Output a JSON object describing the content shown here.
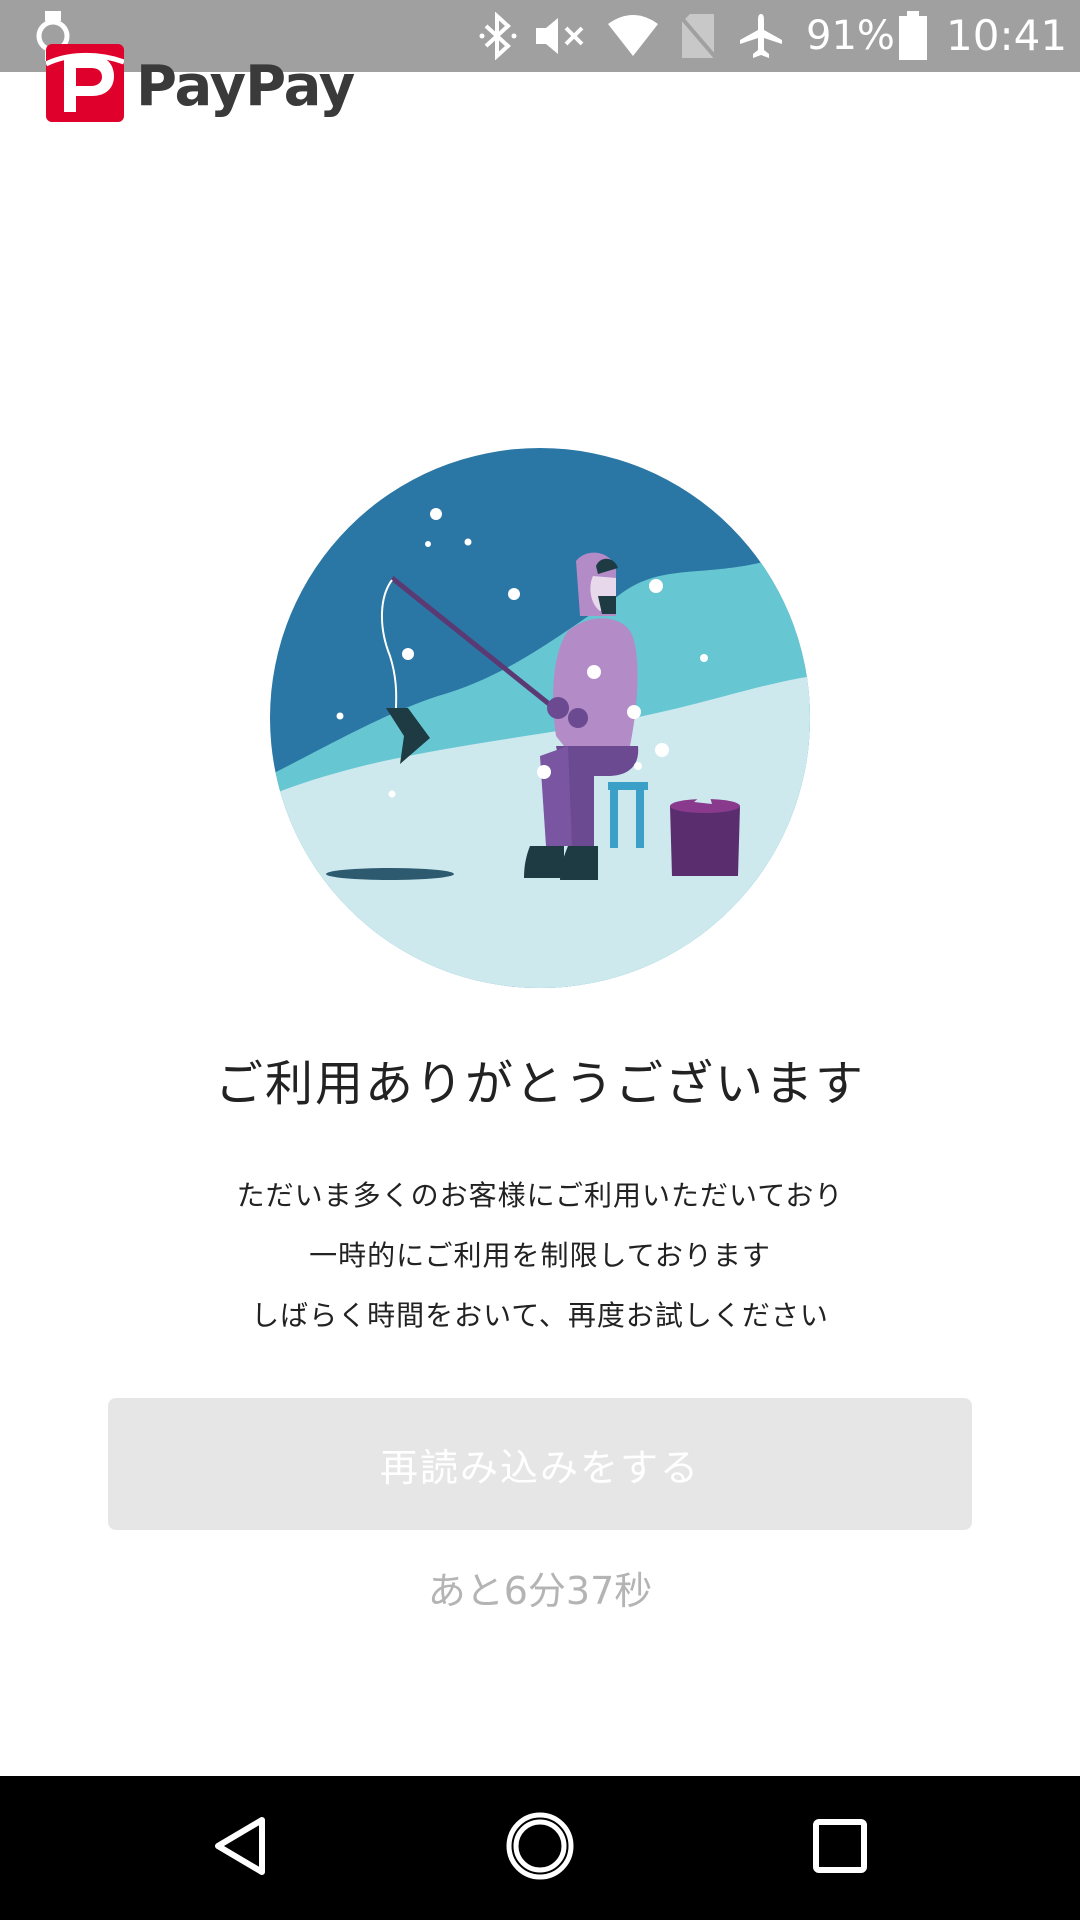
{
  "status_bar": {
    "battery_percent": "91%",
    "time": "10:41",
    "icons": [
      "watch-icon",
      "bluetooth-icon",
      "mute-icon",
      "wifi-icon",
      "no-sim-icon",
      "airplane-icon",
      "battery-icon"
    ]
  },
  "header": {
    "logo_text": "PayPay",
    "brand_color": "#e0002c"
  },
  "main": {
    "title": "ご利用ありがとうございます",
    "message_lines": [
      "ただいま多くのお客様にご利用いただいており",
      "一時的にご利用を制限しております",
      "しばらく時間をおいて、再度お試しください"
    ],
    "reload_button_label": "再読み込みをする",
    "countdown": "あと6分37秒"
  },
  "nav_bar": {
    "buttons": [
      "back-icon",
      "home-icon",
      "recents-icon"
    ]
  },
  "colors": {
    "status_bar_bg": "#a0a0a0",
    "button_disabled_bg": "#e6e6e6",
    "countdown_text": "#b4b4b4",
    "nav_bar_bg": "#000000"
  }
}
